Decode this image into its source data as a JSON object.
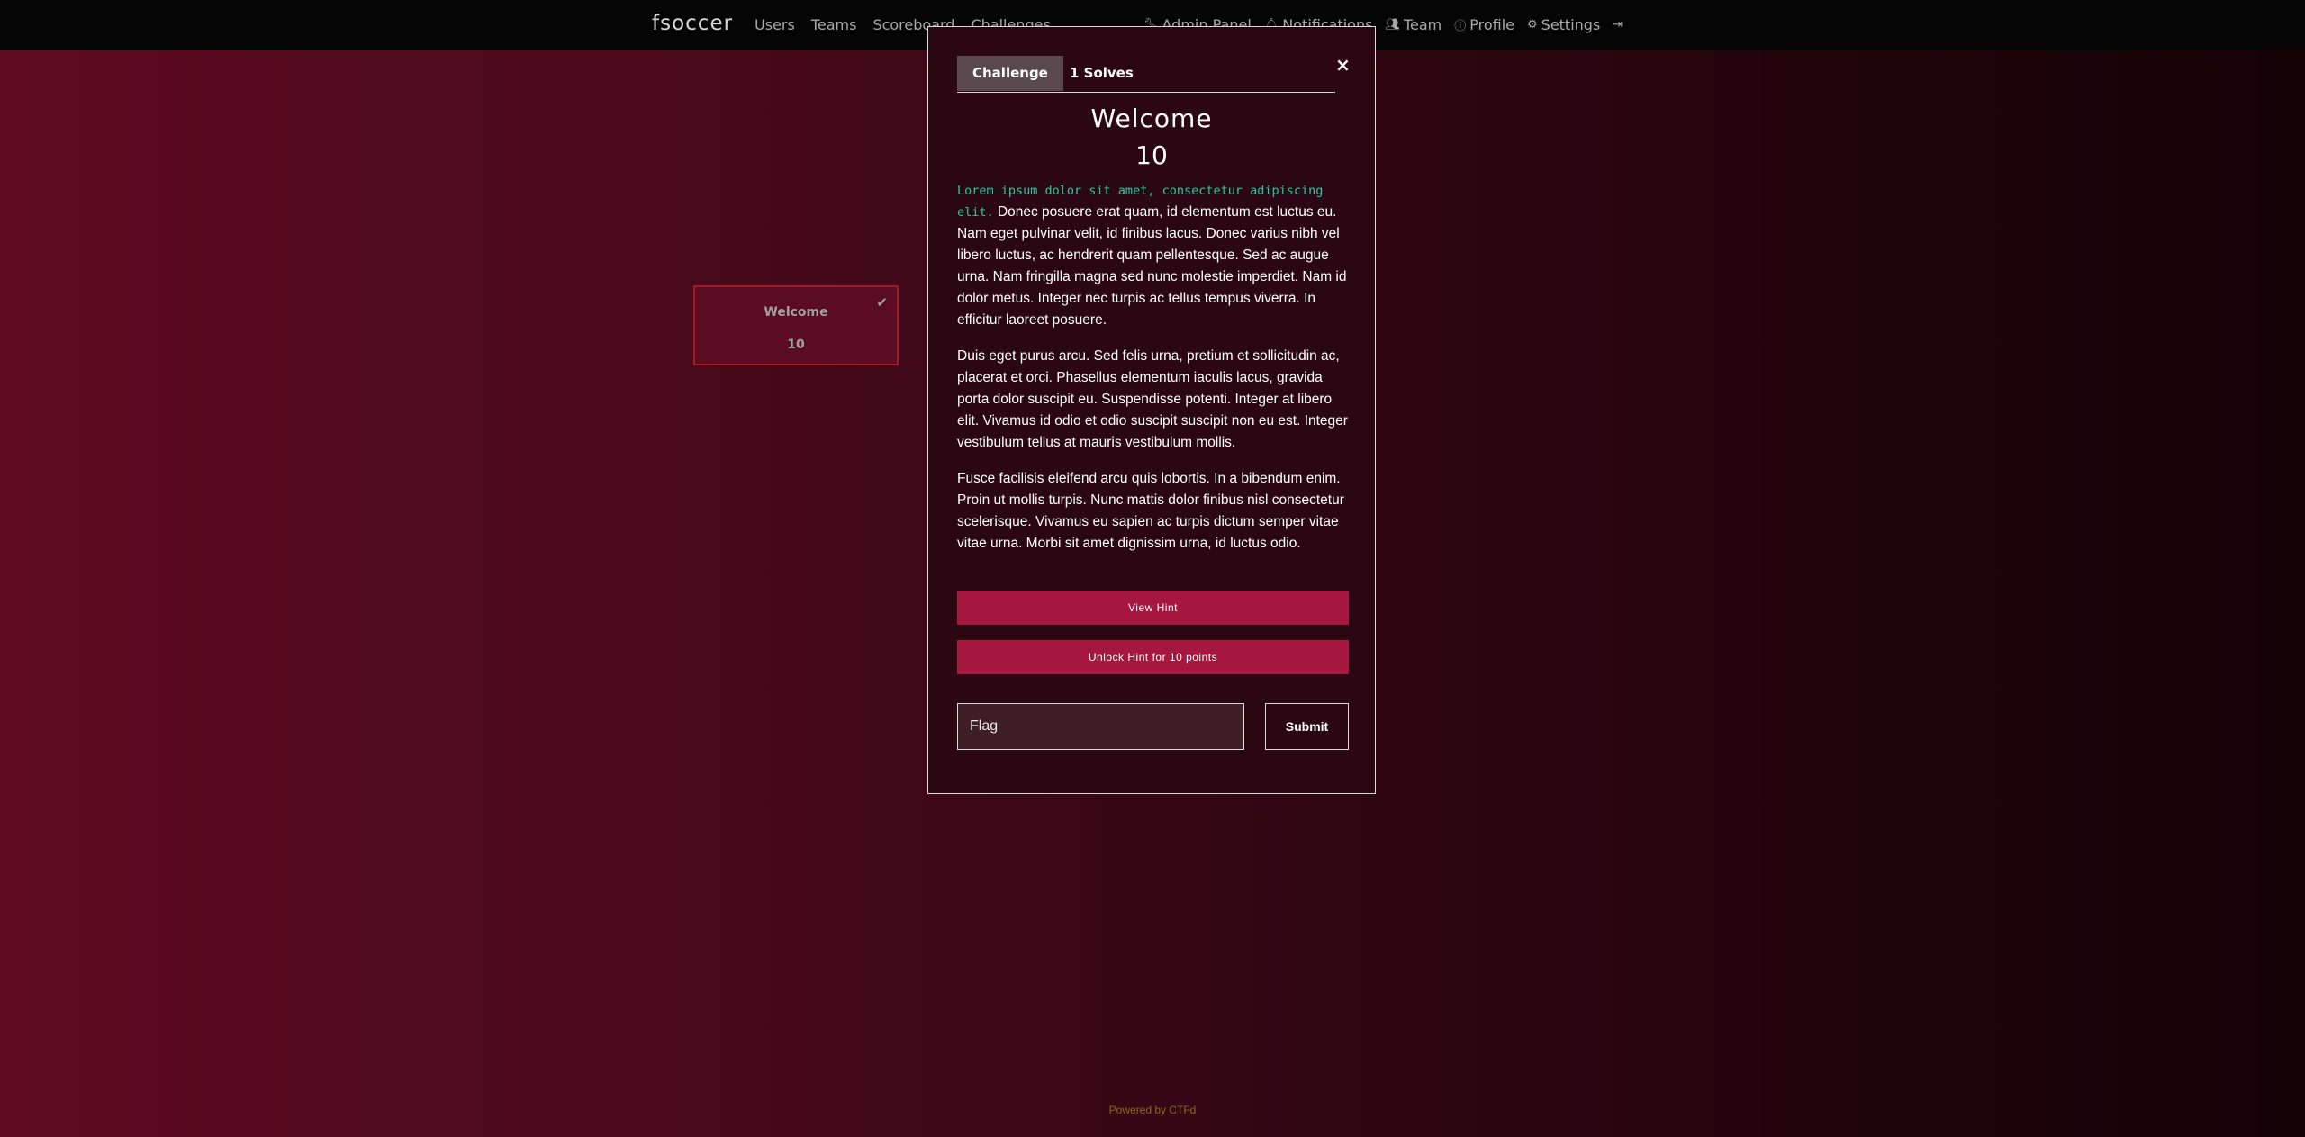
{
  "navbar": {
    "brand": "fsoccer",
    "left_links": [
      {
        "label": "Users"
      },
      {
        "label": "Teams"
      },
      {
        "label": "Scoreboard"
      },
      {
        "label": "Challenges"
      }
    ],
    "right_links": [
      {
        "label": "Admin Panel",
        "icon": "wrench-icon"
      },
      {
        "label": "Notifications",
        "icon": "bell-icon"
      },
      {
        "label": "Team",
        "icon": "users-icon"
      },
      {
        "label": "Profile",
        "icon": "user-circle-icon"
      },
      {
        "label": "Settings",
        "icon": "gears-icon"
      }
    ],
    "logout_icon": "sign-out-icon"
  },
  "challenge_card": {
    "name": "Welcome",
    "value": "10",
    "solved_icon": "check-icon"
  },
  "modal": {
    "tabs": [
      {
        "label": "Challenge",
        "active": true
      },
      {
        "label": "1 Solves",
        "active": false
      }
    ],
    "close_label": "×",
    "title": "Welcome",
    "value": "10",
    "description": {
      "code": "Lorem ipsum dolor sit amet, consectetur adipiscing elit.",
      "p1_rest": " Donec posuere erat quam, id elementum est luctus eu. Nam eget pulvinar velit, id finibus lacus. Donec varius nibh vel libero luctus, ac hendrerit quam pellentesque. Sed ac augue urna. Nam fringilla magna sed nunc molestie imperdiet. Nam id dolor metus. Integer nec turpis ac tellus tempus viverra. In efficitur laoreet posuere.",
      "p2": "Duis eget purus arcu. Sed felis urna, pretium et sollicitudin ac, placerat et orci. Phasellus elementum iaculis lacus, gravida porta dolor suscipit eu. Suspendisse potenti. Integer at libero elit. Vivamus id odio et odio suscipit suscipit non eu est. Integer vestibulum tellus at mauris vestibulum mollis.",
      "p3": "Fusce facilisis eleifend arcu quis lobortis. In a bibendum enim. Proin ut mollis turpis. Nunc mattis dolor finibus nisl consectetur scelerisque. Vivamus eu sapien ac turpis dictum semper vitae vitae urna. Morbi sit amet dignissim urna, id luctus odio."
    },
    "view_hint_label": "View Hint",
    "unlock_hint_label": "Unlock Hint for 10 points",
    "flag_placeholder": "Flag",
    "flag_value": "",
    "submit_label": "Submit"
  },
  "footer": {
    "text": "Powered by CTFd"
  },
  "colors": {
    "accent": "#a6173f",
    "code_text": "#2fc89a",
    "card_border": "#a61a22",
    "footer_text": "#8a6a1c"
  }
}
